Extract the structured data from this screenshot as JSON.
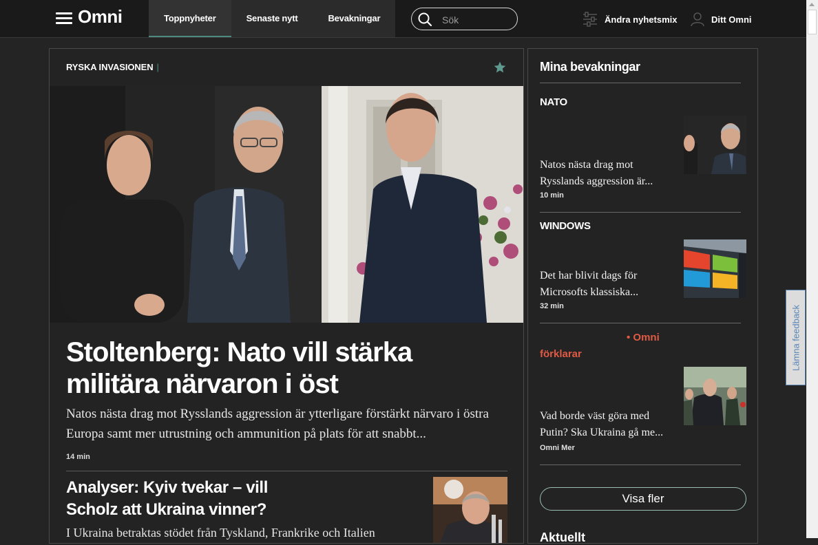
{
  "header": {
    "logo": "Omni",
    "tabs": [
      {
        "label": "Toppnyheter",
        "active": true
      },
      {
        "label": "Senaste nytt",
        "active": false
      },
      {
        "label": "Bevakningar",
        "active": false
      }
    ],
    "search_placeholder": "Sök",
    "mix_label": "Ändra nyhetsmix",
    "profile_label": "Ditt Omni"
  },
  "main": {
    "section_label": "RYSKA INVASIONEN",
    "section_separator": "|",
    "headline": "Stoltenberg: Nato vill stärka militära närvaron i öst",
    "lead": "Natos nästa drag mot Rysslands aggression är ytterligare förstärkt närvaro i östra Europa samt mer utrustning och ammunition på plats för att snabbt...",
    "time": "14 min",
    "second_headline": "Analyser: Kyiv tvekar – vill Scholz att Ukraina vinner?",
    "second_lead": "I Ukraina betraktas stödet från Tyskland, Frankrike och Italien"
  },
  "sidebar": {
    "title": "Mina bevakningar",
    "items": [
      {
        "topic": "NATO",
        "title": "Natos nästa drag mot Rysslands aggression är...",
        "meta": "10 min"
      },
      {
        "topic": "WINDOWS",
        "title": "Det har blivit dags för Microsofts klassiska...",
        "meta": "32 min"
      },
      {
        "tag": "• Omni förklarar",
        "title": "Vad borde väst göra med Putin? Ska Ukraina gå me...",
        "meta": "Omni Mer"
      }
    ],
    "more_button": "Visa fler",
    "next_section": "Aktuellt"
  },
  "feedback_label": "Lämna feedback",
  "colors": {
    "accent": "#4e8a80",
    "omni_red": "#e05a44",
    "background": "#242424"
  }
}
